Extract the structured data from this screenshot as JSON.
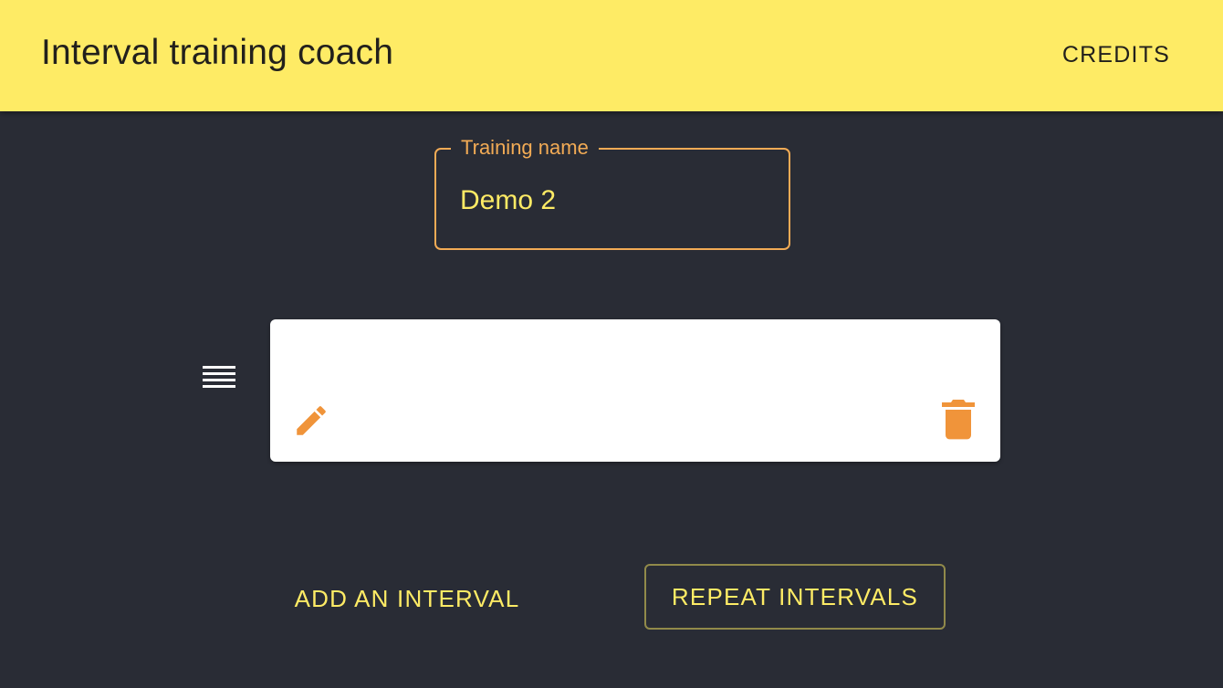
{
  "appbar": {
    "title": "Interval training coach",
    "credits_label": "CREDITS"
  },
  "training": {
    "name_label": "Training name",
    "name_value": "Demo 2"
  },
  "intervals": [
    {
      "edit_icon": "pencil-icon",
      "delete_icon": "trash-icon",
      "drag_icon": "drag-handle-icon"
    }
  ],
  "actions": {
    "add_label": "ADD AN INTERVAL",
    "repeat_label": "REPEAT INTERVALS"
  },
  "colors": {
    "appbar_bg": "#feeb65",
    "page_bg": "#292c35",
    "accent_orange": "#f2ab55",
    "icon_orange": "#f0943a",
    "text_yellow": "#feeb65"
  }
}
